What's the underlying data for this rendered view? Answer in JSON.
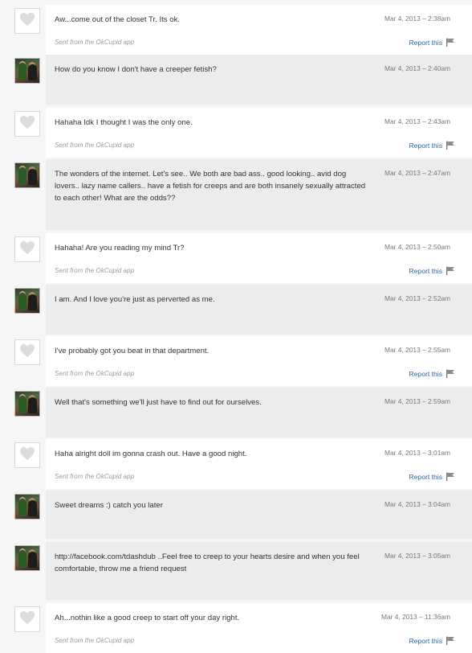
{
  "sent_from": "Sent from the OkCupid app",
  "report_label": "Report this",
  "messages": [
    {
      "sender": "me",
      "text": "Aw...come out of the closet Tr. Its ok.",
      "time": "Mar 4, 2013 – 2:38am"
    },
    {
      "sender": "them",
      "text": "How do you know I don't have a creeper fetish?",
      "time": "Mar 4, 2013 – 2:40am"
    },
    {
      "sender": "me",
      "text": "Hahaha Idk I thought I was the only one.",
      "time": "Mar 4, 2013 – 2:43am"
    },
    {
      "sender": "them",
      "text": "The wonders of the internet. Let's see.. We both are bad ass.. good looking.. avid dog lovers.. lazy name callers.. have a fetish for creeps and are both insanely sexually attracted to each other! What are the odds??",
      "time": "Mar 4, 2013 – 2:47am"
    },
    {
      "sender": "me",
      "text": "Hahaha! Are you reading my mind Tr?",
      "time": "Mar 4, 2013 – 2:50am"
    },
    {
      "sender": "them",
      "text": "I am. And I love you're just as perverted as me.",
      "time": "Mar 4, 2013 – 2:52am"
    },
    {
      "sender": "me",
      "text": "I've probably got you beat in that department.",
      "time": "Mar 4, 2013 – 2:55am"
    },
    {
      "sender": "them",
      "text": "Well that's something we'll just have to find out for ourselves.",
      "time": "Mar 4, 2013 – 2:59am"
    },
    {
      "sender": "me",
      "text": "Haha alright doll im gonna crash out. Have a good night.",
      "time": "Mar 4, 2013 – 3:01am"
    },
    {
      "sender": "them",
      "text": "Sweet dreams :) catch you later",
      "time": "Mar 4, 2013 – 3:04am"
    },
    {
      "sender": "them",
      "text": "http://facebook.com/tdashdub ..Feel free to creep to your hearts desire and when you feel comfortable, throw me a friend request",
      "time": "Mar 4, 2013 – 3:05am"
    },
    {
      "sender": "me",
      "text": "Ah...nothin like a good creep to start off your day right.",
      "time": "Mar 4, 2013 – 11:36am"
    }
  ],
  "icons": {
    "blank_avatar": "heart-icon",
    "report": "flag-icon"
  },
  "colors": {
    "mine_bg": "#ffffff",
    "theirs_bg": "#ececec",
    "link": "#2b63a8",
    "page_bg": "#f6f6f6"
  }
}
